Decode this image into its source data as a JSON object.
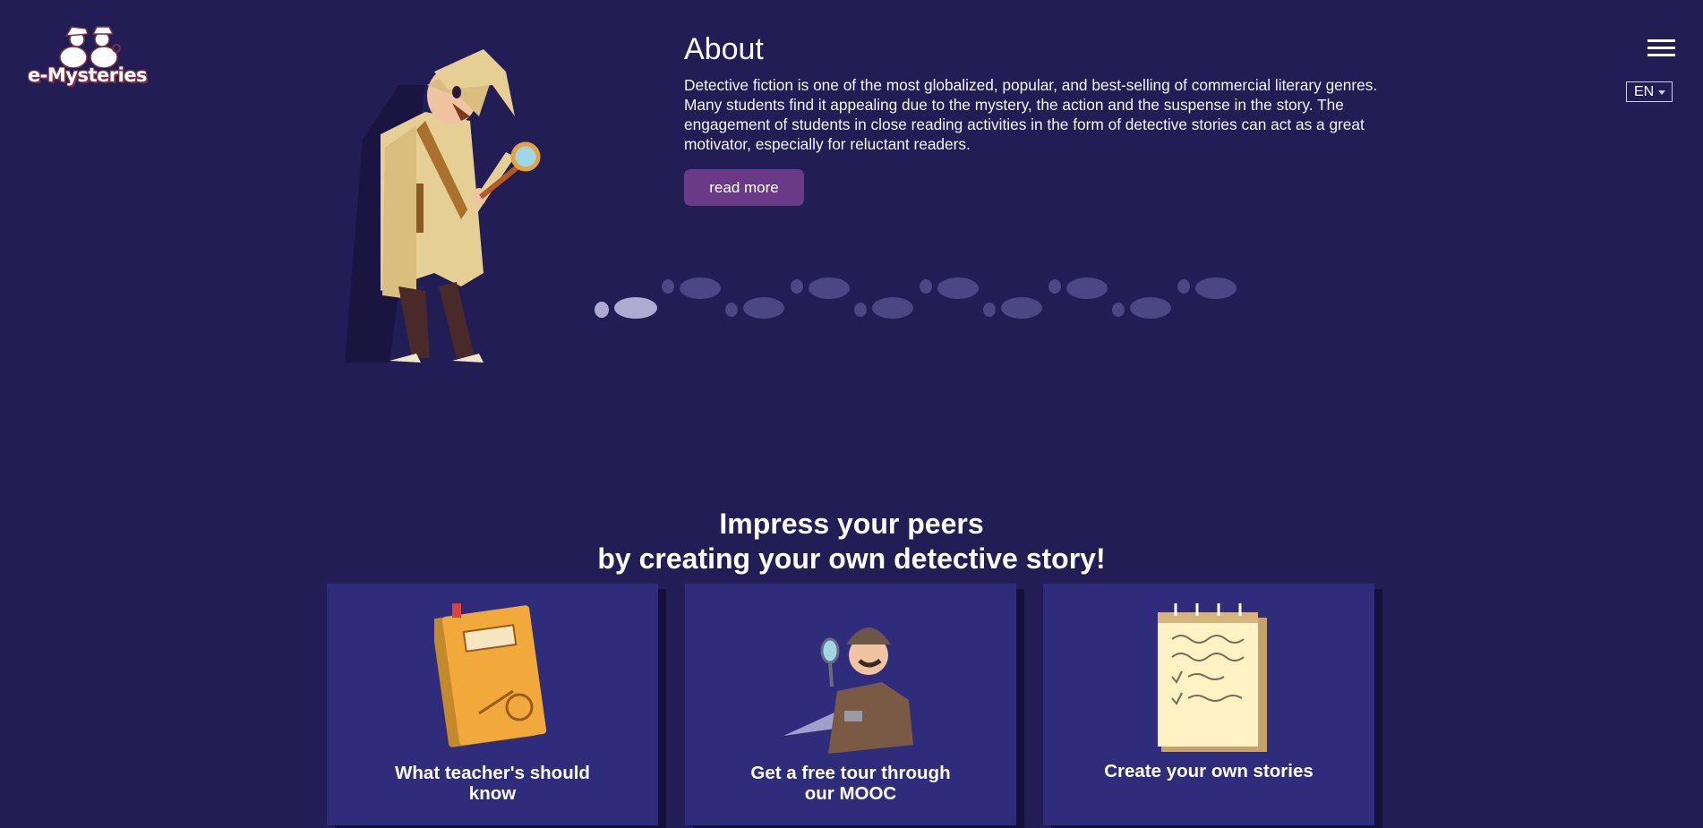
{
  "header": {
    "logo_text": "e-Mysteries",
    "menu_icon": "hamburger-menu-icon",
    "language": "EN"
  },
  "about": {
    "title": "About",
    "text": "Detective fiction is one of the most globalized, popular, and best-selling of commercial literary genres. Many students find it appealing due to the mystery, the action and the suspense in the story. The engagement of students in close reading activities in the form of detective stories can act as a great motivator, especially for reluctant readers.",
    "button_label": "read more"
  },
  "promo": {
    "line1": "Impress your peers",
    "line2": "by creating your own detective story!"
  },
  "cards": [
    {
      "label": "What teacher's should know",
      "icon": "secret-folder-icon"
    },
    {
      "label": "Get a free tour through our MOOC",
      "icon": "detective-flashlight-icon"
    },
    {
      "label": "Create your own stories",
      "icon": "notepad-icon"
    }
  ],
  "colors": {
    "background": "#231d56",
    "card": "#2e2c7b",
    "button": "#6a3a87"
  }
}
